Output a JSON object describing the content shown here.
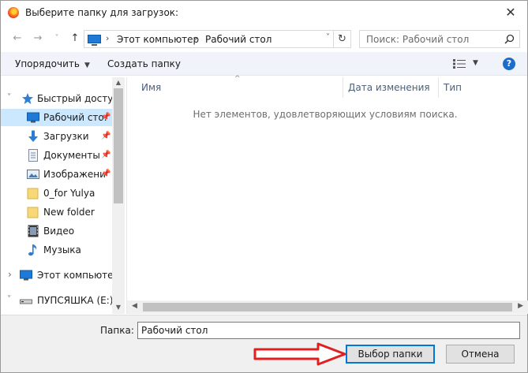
{
  "window": {
    "title": "Выберите папку для загрузок:"
  },
  "nav": {
    "back": "←",
    "forward": "→",
    "recent": "˅",
    "up": "↑",
    "breadcrumb": [
      "Этот компьютер",
      "Рабочий стол"
    ],
    "refresh": "↻",
    "search_placeholder": "Поиск: Рабочий стол"
  },
  "toolbar": {
    "organize": "Упорядочить",
    "new_folder": "Создать папку",
    "help": "?"
  },
  "tree": [
    {
      "label": "Быстрый доступ",
      "icon": "star-icon",
      "expand": "˅",
      "pinned": false,
      "selected": false
    },
    {
      "label": "Рабочий сто.",
      "icon": "desktop-icon",
      "pinned": true,
      "selected": true
    },
    {
      "label": "Загрузки",
      "icon": "download-icon",
      "pinned": true,
      "selected": false
    },
    {
      "label": "Документы",
      "icon": "document-icon",
      "pinned": true,
      "selected": false
    },
    {
      "label": "Изображени",
      "icon": "image-icon",
      "pinned": true,
      "selected": false
    },
    {
      "label": "0_for Yulya",
      "icon": "folder-icon",
      "pinned": false,
      "selected": false
    },
    {
      "label": "New folder",
      "icon": "folder-icon",
      "pinned": false,
      "selected": false
    },
    {
      "label": "Видео",
      "icon": "video-icon",
      "pinned": false,
      "selected": false
    },
    {
      "label": "Музыка",
      "icon": "music-icon",
      "pinned": false,
      "selected": false
    },
    {
      "label": "Этот компьютер",
      "icon": "computer-icon",
      "expand": "›",
      "pinned": false,
      "selected": false
    },
    {
      "label": "ПУПСЯШКА (E:)",
      "icon": "drive-icon",
      "expand": "˅",
      "pinned": false,
      "selected": false
    }
  ],
  "columns": [
    "Имя",
    "Дата изменения",
    "Тип"
  ],
  "empty_message": "Нет элементов, удовлетворяющих условиям поиска.",
  "footer": {
    "folder_label": "Папка:",
    "folder_value": "Рабочий стол",
    "select_button": "Выбор папки",
    "cancel_button": "Отмена"
  },
  "colors": {
    "selection": "#cce8ff",
    "accent": "#0078d7",
    "annotation_arrow": "#e02020"
  }
}
